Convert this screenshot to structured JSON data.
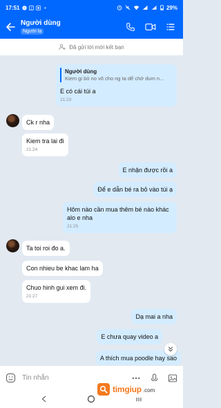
{
  "status_bar": {
    "time": "17:51",
    "battery": "29%"
  },
  "header": {
    "name": "Người dùng",
    "badge": "Người lạ"
  },
  "friend_request": {
    "text": "Đã gửi lời mời kết bạn"
  },
  "messages": [
    {
      "side": "out",
      "quote_name": "Người dùng",
      "quote_text": "Kiem gi bỏ no vô cho ng ta dể chở dum n...",
      "text": "E có cái túi a",
      "time": "21:23"
    },
    {
      "side": "in",
      "text": "Ck r nha"
    },
    {
      "side": "in",
      "text": "Kiem tra lai đi",
      "time": "21:24"
    },
    {
      "side": "out",
      "text": "E nhận được rồi a"
    },
    {
      "side": "out",
      "text": "Để e dẫn bé ra bỏ vào túi ạ"
    },
    {
      "side": "out",
      "text": "Hôm nào cần mua thêm bé nào khác",
      "text2": "alo e nha",
      "time": "21:25"
    },
    {
      "side": "in",
      "text": "Ta toi roi đo a."
    },
    {
      "side": "in",
      "text": "Con nhieu be khac lam ha"
    },
    {
      "side": "in",
      "text": "Chuo hinh gui xem đi.",
      "time": "21:27"
    },
    {
      "side": "out",
      "text": "Dạ mai a nha"
    },
    {
      "side": "out",
      "text": "E chưa quay video a"
    },
    {
      "side": "out",
      "text": "A thích mua poodle hay sao"
    }
  ],
  "input": {
    "placeholder": "Tin nhắn"
  },
  "watermark": {
    "brand": "timgiup",
    "domain": ".com"
  },
  "colors": {
    "brand_blue": "#0068ff",
    "bubble_out": "#d4ecff",
    "bubble_in": "#ffffff",
    "chat_bg": "#e2e9f1",
    "watermark_orange": "#f47a20"
  }
}
